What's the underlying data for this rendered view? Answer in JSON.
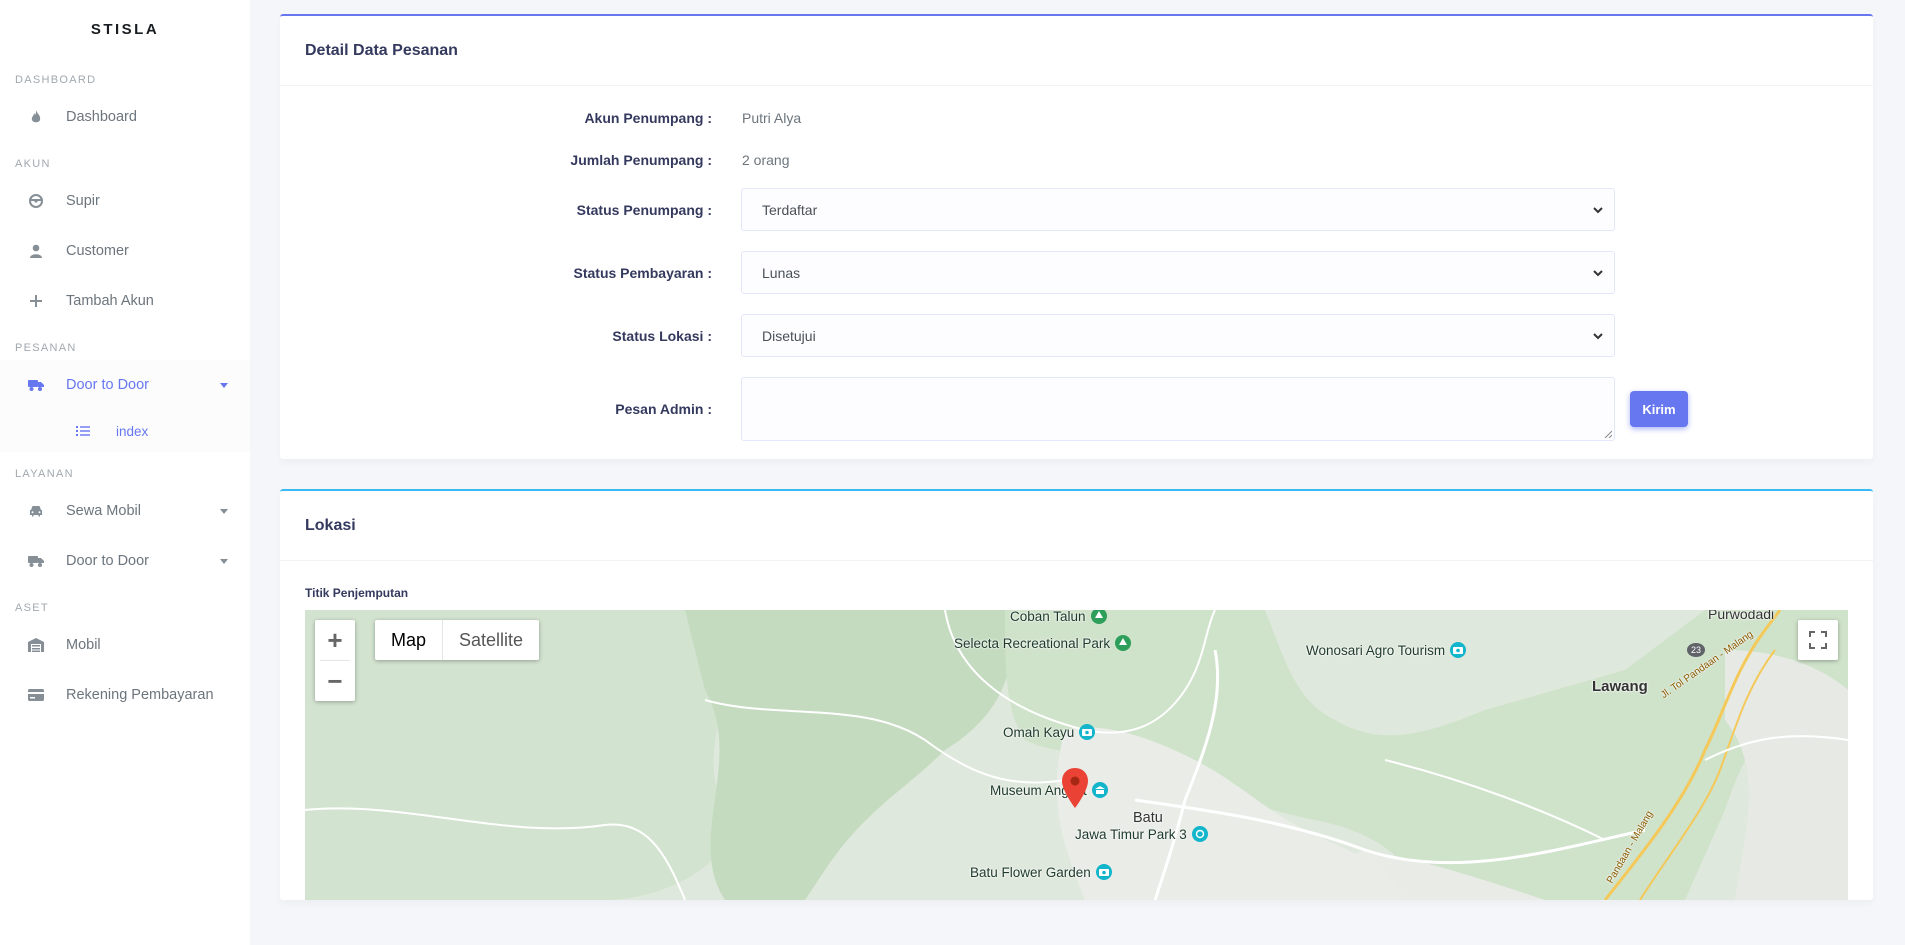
{
  "sidebar": {
    "brand": "STISLA",
    "sections": [
      {
        "header": "DASHBOARD"
      },
      {
        "header": "AKUN"
      },
      {
        "header": "PESANAN"
      },
      {
        "header": "LAYANAN"
      },
      {
        "header": "ASET"
      }
    ],
    "items": {
      "dashboard": "Dashboard",
      "supir": "Supir",
      "customer": "Customer",
      "tambah_akun": "Tambah Akun",
      "door_to_door_pesanan": "Door to Door",
      "index": "index",
      "sewa_mobil": "Sewa Mobil",
      "door_to_door_layanan": "Door to Door",
      "mobil": "Mobil",
      "rekening": "Rekening Pembayaran"
    },
    "icons": {
      "dashboard": "fire-icon",
      "supir": "steering-wheel-icon",
      "customer": "user-icon",
      "tambah_akun": "plus-icon",
      "door_to_door": "truck-icon",
      "index": "list-icon",
      "sewa_mobil": "car-icon",
      "mobil": "warehouse-icon",
      "rekening": "credit-card-icon"
    },
    "accent_color": "#6777ef"
  },
  "detail": {
    "title": "Detail Data Pesanan",
    "akun_label": "Akun Penumpang :",
    "akun_value": "Putri Alya",
    "jumlah_label": "Jumlah Penumpang :",
    "jumlah_value": "2 orang",
    "status_penumpang_label": "Status Penumpang :",
    "status_penumpang_value": "Terdaftar",
    "status_pembayaran_label": "Status Pembayaran :",
    "status_pembayaran_value": "Lunas",
    "status_lokasi_label": "Status Lokasi :",
    "status_lokasi_value": "Disetujui",
    "pesan_label": "Pesan Admin :",
    "pesan_value": "",
    "kirim_button": "Kirim"
  },
  "lokasi": {
    "title": "Lokasi",
    "map_label": "Titik Penjemputan",
    "map_type_map": "Map",
    "map_type_satellite": "Satellite",
    "zoom_in": "+",
    "zoom_out": "−",
    "places": {
      "coban_talun": "Coban Talun",
      "selecta": "Selecta Recreational Park",
      "wonosari": "Wonosari Agro Tourism",
      "purwodadi": "Purwodadi",
      "lawang": "Lawang",
      "omah_kayu": "Omah Kayu",
      "museum_angkut": "Museum Angkut",
      "batu": "Batu",
      "jawa_timur_park": "Jawa Timur Park 3",
      "batu_flower_garden": "Batu Flower Garden",
      "road_23": "23",
      "toll_road": "Jl. Tol Pandaan - Malang",
      "toll_road_2": "Pandaan - Malang"
    }
  }
}
